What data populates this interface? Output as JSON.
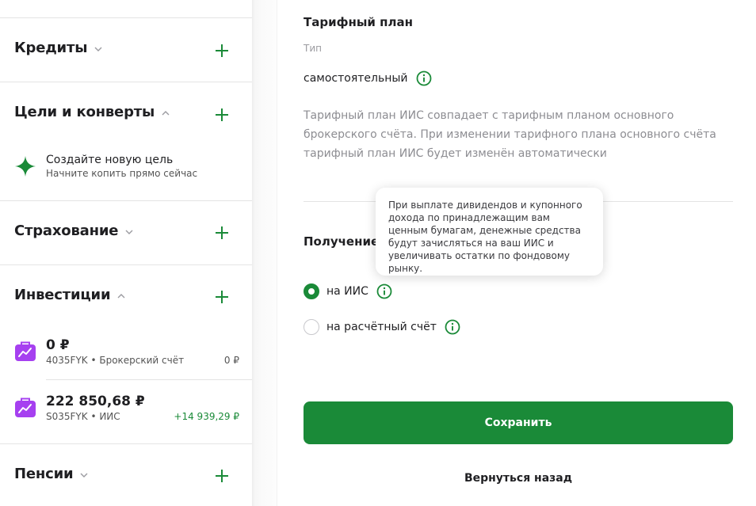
{
  "sidebar": {
    "credits": {
      "title": "Кредиты"
    },
    "goals": {
      "title": "Цели и конверты",
      "new_goal_title": "Создайте новую цель",
      "new_goal_sub": "Начните копить прямо сейчас"
    },
    "insurance": {
      "title": "Страхование"
    },
    "investments": {
      "title": "Инвестиции",
      "accounts": [
        {
          "amount": "0 ₽",
          "sub": "4035FYK • Брокерский счёт",
          "right": "0 ₽"
        },
        {
          "amount": "222 850,68 ₽",
          "sub": "S035FYK • ИИС",
          "right": "+14 939,29 ₽"
        }
      ]
    },
    "pensions": {
      "title": "Пенсии"
    }
  },
  "main": {
    "title": "Тарифный план",
    "type_label": "Тип",
    "type_value": "самостоятельный",
    "description": "Тарифный план ИИС совпадает с тарифным планом основного брокерского счёта. При изменении тарифного плана основного счёта тарифный план ИИС будет изменён автоматически",
    "income_title": "Получение",
    "tooltip": "При выплате дивидендов и купонного дохода по принадлежащим вам ценным бумагам, денежные средства будут зачисляться на ваш ИИС и увеличивать остатки по фондовому рынку.",
    "options": [
      {
        "label": "на ИИС",
        "checked": true
      },
      {
        "label": "на расчётный счёт",
        "checked": false
      }
    ],
    "save_label": "Сохранить",
    "back_label": "Вернуться назад"
  },
  "colors": {
    "accent": "#1a8a38",
    "goal_icon": "#1a8a38",
    "invest_icon": "#a640f0"
  },
  "icons": {
    "plus": "plus-icon",
    "chevron": "chevron-icon",
    "info": "info-icon",
    "sparkle": "sparkle-icon",
    "briefcase": "briefcase-chart-icon"
  }
}
